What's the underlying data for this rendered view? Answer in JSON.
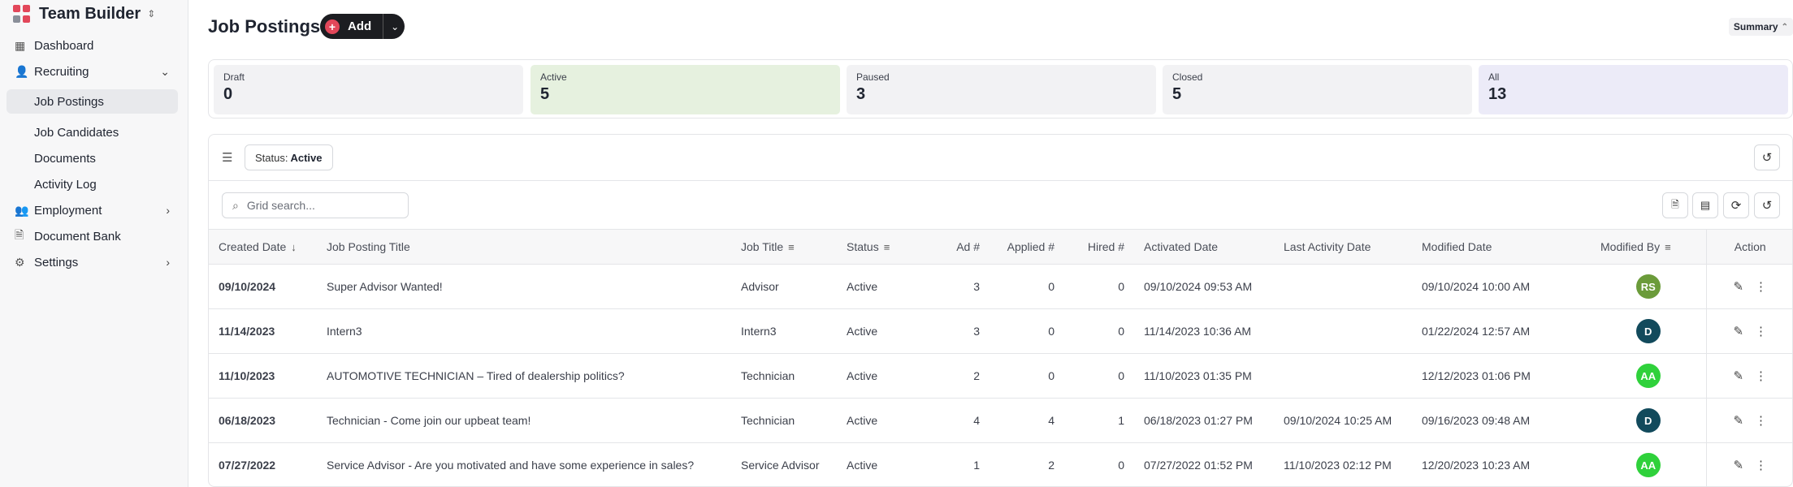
{
  "app": {
    "name": "Team Builder"
  },
  "sidebar": {
    "items": [
      {
        "label": "Dashboard"
      },
      {
        "label": "Recruiting"
      },
      {
        "label": "Employment"
      },
      {
        "label": "Document Bank"
      },
      {
        "label": "Settings"
      }
    ],
    "recruiting_children": [
      {
        "label": "Job Postings",
        "active": true
      },
      {
        "label": "Job Candidates"
      },
      {
        "label": "Documents"
      },
      {
        "label": "Activity Log"
      }
    ]
  },
  "header": {
    "title": "Job Postings",
    "add_label": "Add",
    "summary_label": "Summary"
  },
  "status_cards": [
    {
      "label": "Draft",
      "value": "0",
      "color": "#f2f2f4"
    },
    {
      "label": "Active",
      "value": "5",
      "color": "#e6f1df"
    },
    {
      "label": "Paused",
      "value": "3",
      "color": "#f2f2f4"
    },
    {
      "label": "Closed",
      "value": "5",
      "color": "#f2f2f4"
    },
    {
      "label": "All",
      "value": "13",
      "color": "#ecebf8"
    }
  ],
  "filter": {
    "label": "Status:",
    "value": "Active"
  },
  "search": {
    "placeholder": "Grid search..."
  },
  "table": {
    "columns": [
      "Created Date",
      "Job Posting Title",
      "Job Title",
      "Status",
      "Ad #",
      "Applied #",
      "Hired #",
      "Activated Date",
      "Last Activity Date",
      "Modified Date",
      "Modified By",
      "Action"
    ],
    "rows": [
      {
        "created": "09/10/2024",
        "posting_title": "Super Advisor Wanted!",
        "job_title": "Advisor",
        "status": "Active",
        "ad": "3",
        "applied": "0",
        "hired": "0",
        "activated": "09/10/2024 09:53 AM",
        "last_activity": "",
        "modified": "09/10/2024 10:00 AM",
        "modified_by": "RS",
        "avatar_color": "#6b9b3a"
      },
      {
        "created": "11/14/2023",
        "posting_title": "Intern3",
        "job_title": "Intern3",
        "status": "Active",
        "ad": "3",
        "applied": "0",
        "hired": "0",
        "activated": "11/14/2023 10:36 AM",
        "last_activity": "",
        "modified": "01/22/2024 12:57 AM",
        "modified_by": "D",
        "avatar_color": "#124a5c"
      },
      {
        "created": "11/10/2023",
        "posting_title": "AUTOMOTIVE TECHNICIAN – Tired of dealership politics?",
        "job_title": "Technician",
        "status": "Active",
        "ad": "2",
        "applied": "0",
        "hired": "0",
        "activated": "11/10/2023 01:35 PM",
        "last_activity": "",
        "modified": "12/12/2023 01:06 PM",
        "modified_by": "AA",
        "avatar_color": "#2fd13b"
      },
      {
        "created": "06/18/2023",
        "posting_title": "Technician - Come join our upbeat team!",
        "job_title": "Technician",
        "status": "Active",
        "ad": "4",
        "applied": "4",
        "hired": "1",
        "activated": "06/18/2023 01:27 PM",
        "last_activity": "09/10/2024 10:25 AM",
        "modified": "09/16/2023 09:48 AM",
        "modified_by": "D",
        "avatar_color": "#124a5c"
      },
      {
        "created": "07/27/2022",
        "posting_title": "Service Advisor - Are you motivated and have some experience in sales?",
        "job_title": "Service Advisor",
        "status": "Active",
        "ad": "1",
        "applied": "2",
        "hired": "0",
        "activated": "07/27/2022 01:52 PM",
        "last_activity": "11/10/2023 02:12 PM",
        "modified": "12/20/2023 10:23 AM",
        "modified_by": "AA",
        "avatar_color": "#2fd13b"
      }
    ]
  }
}
